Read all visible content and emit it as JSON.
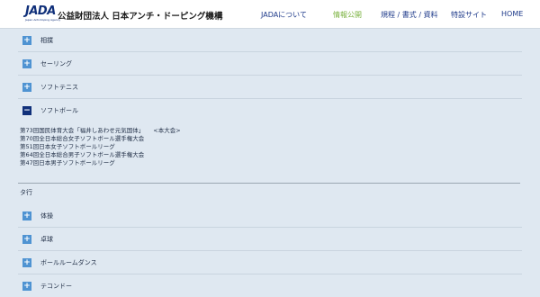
{
  "header": {
    "logo_text": "JADA",
    "logo_sub": "Japan Anti-Doping Agency",
    "org_name": "公益財団法人 日本アンチ・ドーピング機構",
    "nav": [
      {
        "label": "JADAについて",
        "active": false
      },
      {
        "label": "情報公開",
        "active": true
      },
      {
        "label": "規程 / 書式 / 資料",
        "active": false
      },
      {
        "label": "特設サイト",
        "active": false
      },
      {
        "label": "HOME",
        "active": false
      }
    ]
  },
  "accordion_top": [
    {
      "label": "相撲",
      "expanded": false,
      "symbol": "+"
    },
    {
      "label": "セーリング",
      "expanded": false,
      "symbol": "+"
    },
    {
      "label": "ソフトテニス",
      "expanded": false,
      "symbol": "+"
    },
    {
      "label": "ソフトボール",
      "expanded": true,
      "symbol": "−"
    }
  ],
  "softball_events": [
    {
      "name": "第73回国民体育大会「福井しあわせ元気国体」",
      "badge": "<本大会>"
    },
    {
      "name": "第70回全日本総合女子ソフトボール選手権大会",
      "badge": ""
    },
    {
      "name": "第51回日本女子ソフトボールリーグ",
      "badge": ""
    },
    {
      "name": "第64回全日本総合男子ソフトボール選手権大会",
      "badge": ""
    },
    {
      "name": "第47回日本男子ソフトボールリーグ",
      "badge": ""
    }
  ],
  "section_label": "タ行",
  "accordion_bottom": [
    {
      "label": "体操",
      "expanded": false,
      "symbol": "+"
    },
    {
      "label": "卓球",
      "expanded": false,
      "symbol": "+"
    },
    {
      "label": "ボールルームダンス",
      "expanded": false,
      "symbol": "+"
    },
    {
      "label": "テコンドー",
      "expanded": false,
      "symbol": "+"
    }
  ],
  "colors": {
    "background": "#dfe8f1",
    "brand_navy": "#10307a",
    "expand_button": "#4f93d2",
    "nav_active": "#7cb342"
  }
}
